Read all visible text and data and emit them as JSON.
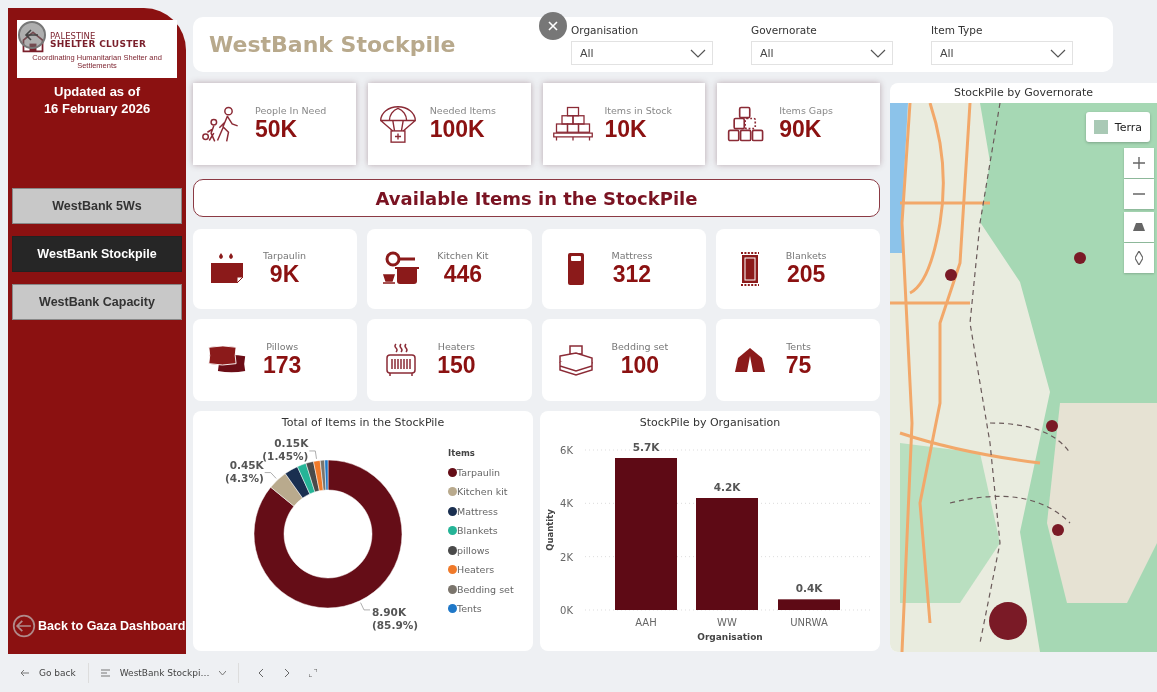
{
  "sidebar": {
    "logo": {
      "line_1": "PALESTINE",
      "line_2": "SHELTER CLUSTER",
      "tagline": "Coordinating Humanitarian Shelter and Settlements"
    },
    "updated": [
      "Updated as of",
      "16 February 2026"
    ],
    "nav": [
      {
        "label": "WestBank 5Ws",
        "selected": false
      },
      {
        "label": "WestBank Stockpile",
        "selected": true
      },
      {
        "label": "WestBank Capacity",
        "selected": false
      }
    ],
    "back_link": "Back to Gaza Dashboard"
  },
  "header": {
    "title": "WestBank Stockpile",
    "filters": [
      {
        "label": "Organisation",
        "value": "All"
      },
      {
        "label": "Governorate",
        "value": "All"
      },
      {
        "label": "Item Type",
        "value": "All"
      }
    ]
  },
  "kpis": [
    {
      "label": "People In Need",
      "value": "50K"
    },
    {
      "label": "Needed Items",
      "value": "100K"
    },
    {
      "label": "Items in Stock",
      "value": "10K"
    },
    {
      "label": "Items Gaps",
      "value": "90K"
    }
  ],
  "banner": "Available Items in the StockPile",
  "items": [
    {
      "label": "Tarpaulin",
      "value": "9K"
    },
    {
      "label": "Kitchen Kit",
      "value": "446"
    },
    {
      "label": "Mattress",
      "value": "312"
    },
    {
      "label": "Blankets",
      "value": "205"
    },
    {
      "label": "Pillows",
      "value": "173"
    },
    {
      "label": "Heaters",
      "value": "150"
    },
    {
      "label": "Bedding set",
      "value": "100"
    },
    {
      "label": "Tents",
      "value": "75"
    }
  ],
  "donut_chart": {
    "chart_data": {
      "type": "donut",
      "title": "Total of Items in the StockPile",
      "categories": [
        "Tarpaulin",
        "Kitchen kit",
        "Mattress",
        "Blankets",
        "pillows",
        "Heaters",
        "Bedding set",
        "Tents"
      ],
      "series": [
        {
          "name": "Items",
          "values": [
            85.9,
            4.3,
            3.01,
            1.98,
            1.67,
            1.45,
            0.97,
            0.72
          ]
        }
      ],
      "value_labels": [
        "8.90K (85.9%)",
        "0.45K (4.3%)",
        null,
        null,
        null,
        "0.15K (1.45%)",
        null,
        null
      ]
    },
    "legend": {
      "entries": [
        {
          "color": "#650d17"
        },
        {
          "color": "#b9aa8d"
        },
        {
          "color": "#1a2f50"
        },
        {
          "color": "#25b497"
        },
        {
          "color": "#4a4a4a"
        },
        {
          "color": "#f07a2a"
        },
        {
          "color": "#7b756d"
        },
        {
          "color": "#1f78c8"
        }
      ]
    }
  },
  "bar_chart": {
    "chart_data": {
      "type": "bar",
      "title": "StockPile by Organisation",
      "xlabel": "Organisation",
      "ylabel": "Quantity",
      "categories": [
        "AAH",
        "WW",
        "UNRWA"
      ],
      "series": [
        {
          "color": "#5e0a15",
          "values": [
            5700,
            4200,
            400
          ]
        }
      ],
      "ylim": [
        0,
        6000
      ],
      "yticks": [
        {
          "value": 0,
          "label": "0K"
        },
        {
          "value": 2000,
          "label": "2K"
        },
        {
          "value": 4000,
          "label": "4K"
        },
        {
          "value": 6000,
          "label": "6K"
        }
      ],
      "value_labels": [
        "5.7K",
        "4.2K",
        "0.4K"
      ]
    }
  },
  "map": {
    "title": "StockPile by Governorate",
    "style_button": "Terra"
  },
  "bottom_bar": {
    "back": "Go back",
    "page": "WestBank Stockpi…"
  }
}
